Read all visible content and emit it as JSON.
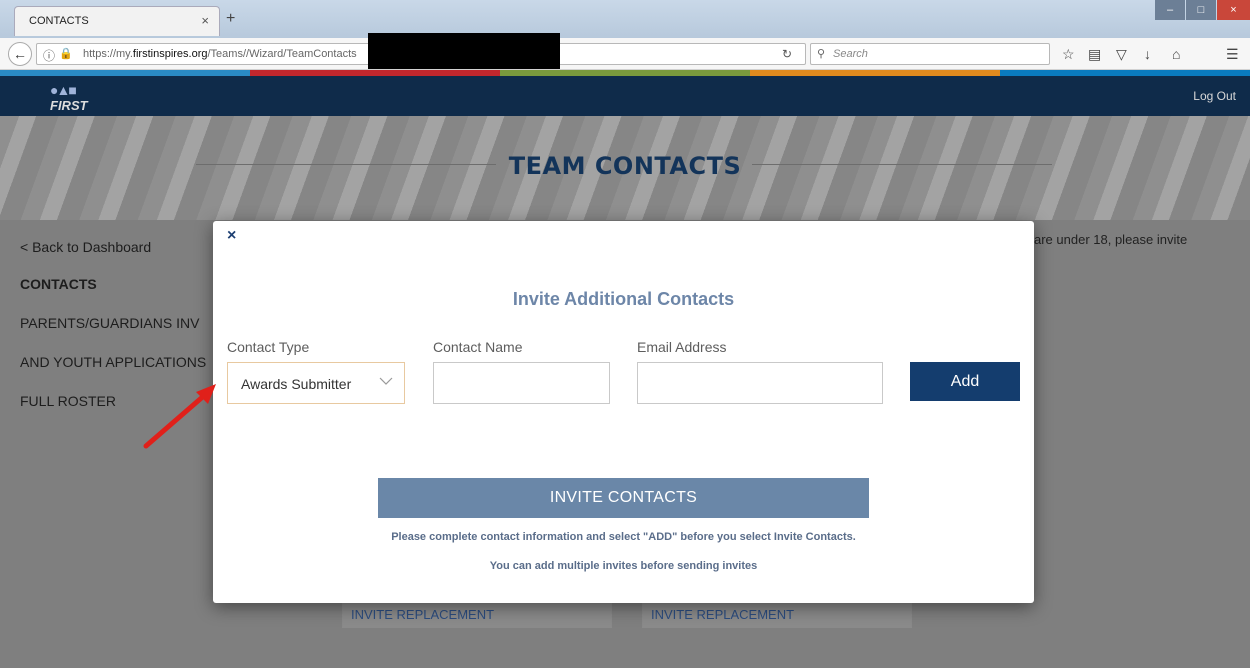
{
  "browser": {
    "tab_title": "CONTACTS",
    "tab_close": "×",
    "new_tab": "+",
    "url_prefix": "https://my.",
    "url_domain": "firstinspires.org",
    "url_path": "/Teams//Wizard/TeamContacts",
    "search_placeholder": "Search",
    "window_controls": {
      "minimize": "–",
      "maximize": "□",
      "close": "×"
    },
    "toolbar_icons": [
      "bookmark-star-icon",
      "reading-list-icon",
      "pocket-icon",
      "download-icon",
      "home-icon",
      "menu-icon"
    ]
  },
  "site": {
    "brand_colors": [
      "#2a8ac4",
      "#c2272d",
      "#7a9a3d",
      "#e08a1e",
      "#0a7bbf"
    ],
    "logo_text": "FIRST",
    "logout": "Log Out",
    "page_title": "TEAM CONTACTS"
  },
  "sidebar": {
    "items": [
      {
        "label": "< Back to Dashboard",
        "bold": false
      },
      {
        "label": "CONTACTS",
        "bold": true
      },
      {
        "label": "PARENTS/GUARDIANS INV",
        "bold": false
      },
      {
        "label": "AND YOUTH APPLICATIONS",
        "bold": false
      },
      {
        "label": "FULL ROSTER",
        "bold": false
      }
    ]
  },
  "background": {
    "under18_text": "are under 18, please invite",
    "replace_buttons": [
      "INVITE REPLACEMENT",
      "INVITE REPLACEMENT"
    ]
  },
  "modal": {
    "close": "×",
    "title": "Invite Additional Contacts",
    "fields": {
      "contact_type_label": "Contact Type",
      "contact_type_value": "Awards Submitter",
      "contact_name_label": "Contact Name",
      "contact_name_value": "",
      "email_label": "Email Address",
      "email_value": ""
    },
    "add_button": "Add",
    "invite_button": "INVITE CONTACTS",
    "note_1": "Please complete contact information and select \"ADD\" before you select Invite Contacts.",
    "note_2": "You can add multiple invites before sending invites"
  },
  "annotation": {
    "arrow_color": "#e0201a"
  }
}
